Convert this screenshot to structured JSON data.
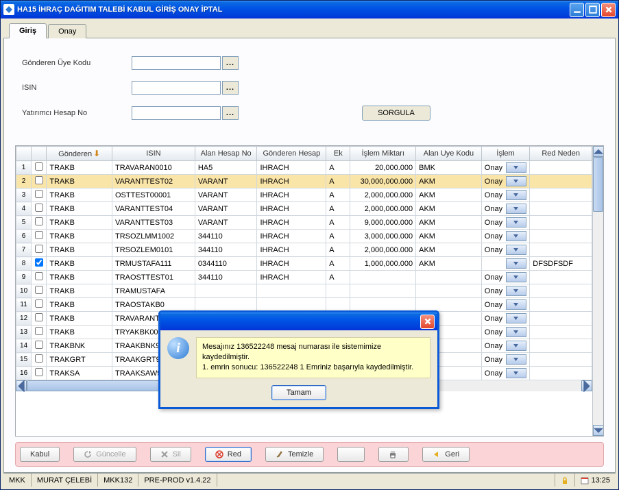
{
  "window": {
    "title": "HA15 İHRAÇ DAĞITIM TALEBİ KABUL GİRİŞ ONAY İPTAL"
  },
  "tabs": {
    "giris": "Giriş",
    "onay": "Onay"
  },
  "form": {
    "gonderen_label": "Gönderen Üye Kodu",
    "isin_label": "ISIN",
    "hesap_label": "Yatırımcı Hesap No",
    "query_btn": "SORGULA",
    "gonderen_value": "",
    "isin_value": "",
    "hesap_value": ""
  },
  "grid": {
    "headers": {
      "gonderen": "Gönderen",
      "isin": "ISIN",
      "alan_hesap": "Alan Hesap No",
      "gonderen_hesap": "Gönderen Hesap",
      "ek": "Ek",
      "islem_miktari": "İşlem Miktarı",
      "alan_uye": "Alan Uye Kodu",
      "islem": "İşlem",
      "red_neden": "Red Neden"
    },
    "rows": [
      {
        "n": "1",
        "chk": false,
        "sel": false,
        "gonderen": "TRAKB",
        "isin": "TRAVARAN0010",
        "alan": "HA5",
        "ghes": "IHRACH",
        "ek": "A",
        "mik": "20,000.000",
        "auy": "BMK",
        "islem": "Onay",
        "red": ""
      },
      {
        "n": "2",
        "chk": false,
        "sel": true,
        "gonderen": "TRAKB",
        "isin": "VARANTTEST02",
        "alan": "VARANT",
        "ghes": "IHRACH",
        "ek": "A",
        "mik": "30,000,000.000",
        "auy": "AKM",
        "islem": "Onay",
        "red": ""
      },
      {
        "n": "3",
        "chk": false,
        "sel": false,
        "gonderen": "TRAKB",
        "isin": "OSTTEST00001",
        "alan": "VARANT",
        "ghes": "IHRACH",
        "ek": "A",
        "mik": "2,000,000.000",
        "auy": "AKM",
        "islem": "Onay",
        "red": ""
      },
      {
        "n": "4",
        "chk": false,
        "sel": false,
        "gonderen": "TRAKB",
        "isin": "VARANTTEST04",
        "alan": "VARANT",
        "ghes": "IHRACH",
        "ek": "A",
        "mik": "2,000,000.000",
        "auy": "AKM",
        "islem": "Onay",
        "red": ""
      },
      {
        "n": "5",
        "chk": false,
        "sel": false,
        "gonderen": "TRAKB",
        "isin": "VARANTTEST03",
        "alan": "VARANT",
        "ghes": "IHRACH",
        "ek": "A",
        "mik": "9,000,000.000",
        "auy": "AKM",
        "islem": "Onay",
        "red": ""
      },
      {
        "n": "6",
        "chk": false,
        "sel": false,
        "gonderen": "TRAKB",
        "isin": "TRSOZLMM1002",
        "alan": "344110",
        "ghes": "IHRACH",
        "ek": "A",
        "mik": "3,000,000.000",
        "auy": "AKM",
        "islem": "Onay",
        "red": ""
      },
      {
        "n": "7",
        "chk": false,
        "sel": false,
        "gonderen": "TRAKB",
        "isin": "TRSOZLEM0101",
        "alan": "344110",
        "ghes": "IHRACH",
        "ek": "A",
        "mik": "2,000,000.000",
        "auy": "AKM",
        "islem": "Onay",
        "red": ""
      },
      {
        "n": "8",
        "chk": true,
        "sel": false,
        "gonderen": "TRAKB",
        "isin": "TRMUSTAFA111",
        "alan": "0344110",
        "ghes": "IHRACH",
        "ek": "A",
        "mik": "1,000,000.000",
        "auy": "AKM",
        "islem": "",
        "red": "DFSDFSDF"
      },
      {
        "n": "9",
        "chk": false,
        "sel": false,
        "gonderen": "TRAKB",
        "isin": "TRAOSTTEST01",
        "alan": "344110",
        "ghes": "IHRACH",
        "ek": "A",
        "mik": "",
        "auy": "",
        "islem": "Onay",
        "red": ""
      },
      {
        "n": "10",
        "chk": false,
        "sel": false,
        "gonderen": "TRAKB",
        "isin": "TRAMUSTAFA",
        "alan": "",
        "ghes": "",
        "ek": "",
        "mik": "",
        "auy": "",
        "islem": "Onay",
        "red": ""
      },
      {
        "n": "11",
        "chk": false,
        "sel": false,
        "gonderen": "TRAKB",
        "isin": "TRAOSTAKB0",
        "alan": "",
        "ghes": "",
        "ek": "",
        "mik": "",
        "auy": "",
        "islem": "Onay",
        "red": ""
      },
      {
        "n": "12",
        "chk": false,
        "sel": false,
        "gonderen": "TRAKB",
        "isin": "TRAVARANT1",
        "alan": "",
        "ghes": "",
        "ek": "",
        "mik": "",
        "auy": "",
        "islem": "Onay",
        "red": ""
      },
      {
        "n": "13",
        "chk": false,
        "sel": false,
        "gonderen": "TRAKB",
        "isin": "TRYAKBK000",
        "alan": "",
        "ghes": "",
        "ek": "",
        "mik": "",
        "auy": "",
        "islem": "Onay",
        "red": ""
      },
      {
        "n": "14",
        "chk": false,
        "sel": false,
        "gonderen": "TRAKBNK",
        "isin": "TRAAKBNK91",
        "alan": "",
        "ghes": "",
        "ek": "",
        "mik": "",
        "auy": "",
        "islem": "Onay",
        "red": ""
      },
      {
        "n": "15",
        "chk": false,
        "sel": false,
        "gonderen": "TRAKGRT",
        "isin": "TRAAKGRT91",
        "alan": "",
        "ghes": "",
        "ek": "",
        "mik": "",
        "auy": "",
        "islem": "Onay",
        "red": ""
      },
      {
        "n": "16",
        "chk": false,
        "sel": false,
        "gonderen": "TRAKSA",
        "isin": "TRAAKSAW91",
        "alan": "",
        "ghes": "",
        "ek": "",
        "mik": "",
        "auy": "",
        "islem": "Onay",
        "red": ""
      }
    ]
  },
  "dialog": {
    "message_line1": "Mesajınız 136522248 mesaj numarası ile sistemimize kaydedilmiştir.",
    "message_line2": "1. emrin sonucu:  136522248    1   Emriniz başarıyla kaydedilmiştir.",
    "ok_label": "Tamam"
  },
  "actions": {
    "kabul": "Kabul",
    "guncelle": "Güncelle",
    "sil": "Sil",
    "red": "Red",
    "temizle": "Temizle",
    "geri": "Geri"
  },
  "status": {
    "c1": "MKK",
    "c2": "MURAT ÇELEBİ",
    "c3": "MKK132",
    "c4": "PRE-PROD v1.4.22",
    "time": "13:25"
  }
}
